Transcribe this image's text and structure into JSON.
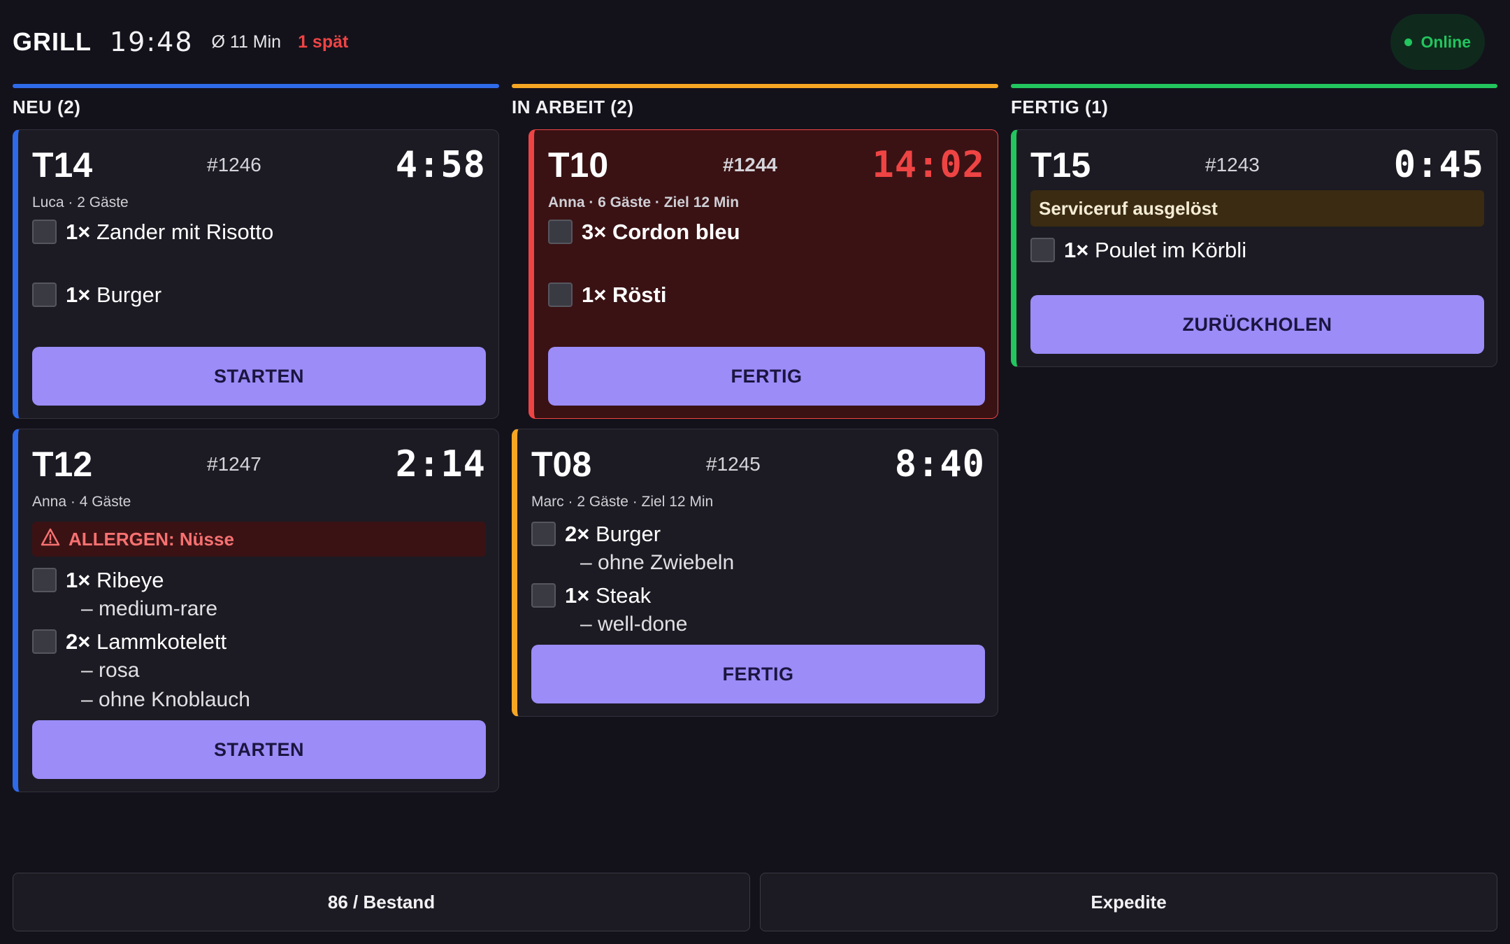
{
  "header": {
    "station": "GRILL",
    "clock": "19:48",
    "avg": "Ø 11 Min",
    "late": "1 spät",
    "status": "Online"
  },
  "colors": {
    "neu": "#2f6ae8",
    "in_arbeit": "#f5a623",
    "fertig": "#22c55e",
    "late": "#ef4444",
    "button": "#9b8cf8"
  },
  "columns": {
    "neu": {
      "title": "NEU (2)",
      "cards": [
        {
          "table": "T14",
          "order": "#1246",
          "timer": "4:58",
          "meta": "Luca · 2 Gäste",
          "items": [
            {
              "qty": "1×",
              "name": "Zander mit Risotto"
            },
            {
              "qty": "1×",
              "name": "Burger"
            }
          ],
          "button": "STARTEN"
        },
        {
          "table": "T12",
          "order": "#1247",
          "timer": "2:14",
          "meta": "Anna · 4 Gäste",
          "allergen": "ALLERGEN: Nüsse",
          "items": [
            {
              "qty": "1×",
              "name": "Ribeye",
              "mods": [
                "– medium-rare"
              ]
            },
            {
              "qty": "2×",
              "name": "Lammkotelett",
              "mods": [
                "– rosa",
                "– ohne Knoblauch"
              ]
            }
          ],
          "button": "STARTEN"
        }
      ]
    },
    "in_arbeit": {
      "title": "IN ARBEIT (2)",
      "cards": [
        {
          "table": "T10",
          "order": "#1244",
          "timer": "14:02",
          "meta": "Anna · 6 Gäste · Ziel 12 Min",
          "items": [
            {
              "qty": "3×",
              "name": "Cordon bleu"
            },
            {
              "qty": "1×",
              "name": "Rösti"
            }
          ],
          "button": "FERTIG"
        },
        {
          "table": "T08",
          "order": "#1245",
          "timer": "8:40",
          "meta": "Marc · 2 Gäste · Ziel 12 Min",
          "items": [
            {
              "qty": "2×",
              "name": "Burger",
              "mods": [
                "– ohne Zwiebeln"
              ]
            },
            {
              "qty": "1×",
              "name": "Steak",
              "mods": [
                "– well-done"
              ]
            }
          ],
          "button": "FERTIG"
        }
      ]
    },
    "fertig": {
      "title": "FERTIG (1)",
      "cards": [
        {
          "table": "T15",
          "order": "#1243",
          "timer": "0:45",
          "service": "Serviceruf ausgelöst",
          "items": [
            {
              "qty": "1×",
              "name": "Poulet im Körbli"
            }
          ],
          "button": "ZURÜCKHOLEN"
        }
      ]
    }
  },
  "footer": {
    "left": "86 / Bestand",
    "right": "Expedite"
  }
}
